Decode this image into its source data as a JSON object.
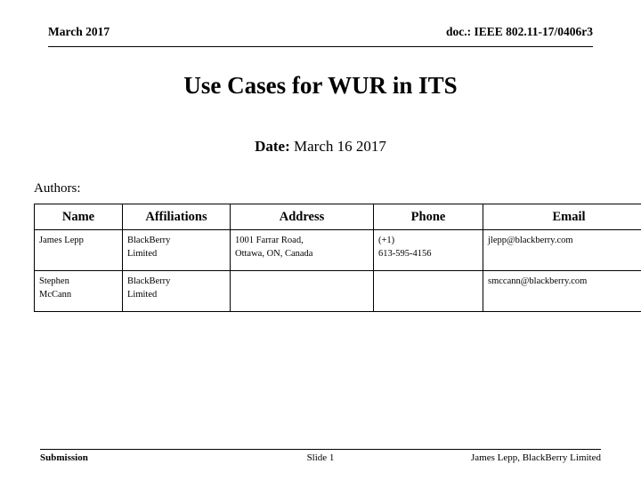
{
  "header": {
    "left": "March 2017",
    "right": "doc.: IEEE 802.11-17/0406r3"
  },
  "title": "Use Cases for WUR in ITS",
  "date": {
    "label": "Date:",
    "value": "March 16 2017"
  },
  "authors": {
    "label": "Authors:",
    "columns": [
      "Name",
      "Affiliations",
      "Address",
      "Phone",
      "Email"
    ],
    "rows": [
      {
        "name_line1": "James Lepp",
        "name_line2": "",
        "affiliation_line1": "BlackBerry",
        "affiliation_line2": "Limited",
        "address_line1": "1001 Farrar Road,",
        "address_line2": "Ottawa, ON, Canada",
        "phone_line1": "(+1)",
        "phone_line2": "613-595-4156",
        "email": "jlepp@blackberry.com"
      },
      {
        "name_line1": "Stephen",
        "name_line2": "McCann",
        "affiliation_line1": "BlackBerry",
        "affiliation_line2": "Limited",
        "address_line1": "",
        "address_line2": "",
        "phone_line1": "",
        "phone_line2": "",
        "email": "smccann@blackberry.com"
      }
    ]
  },
  "footer": {
    "left": "Submission",
    "center": "Slide 1",
    "right": "James Lepp, BlackBerry Limited"
  },
  "colors": {
    "text": "#000000",
    "background": "#ffffff",
    "rule": "#000000"
  }
}
